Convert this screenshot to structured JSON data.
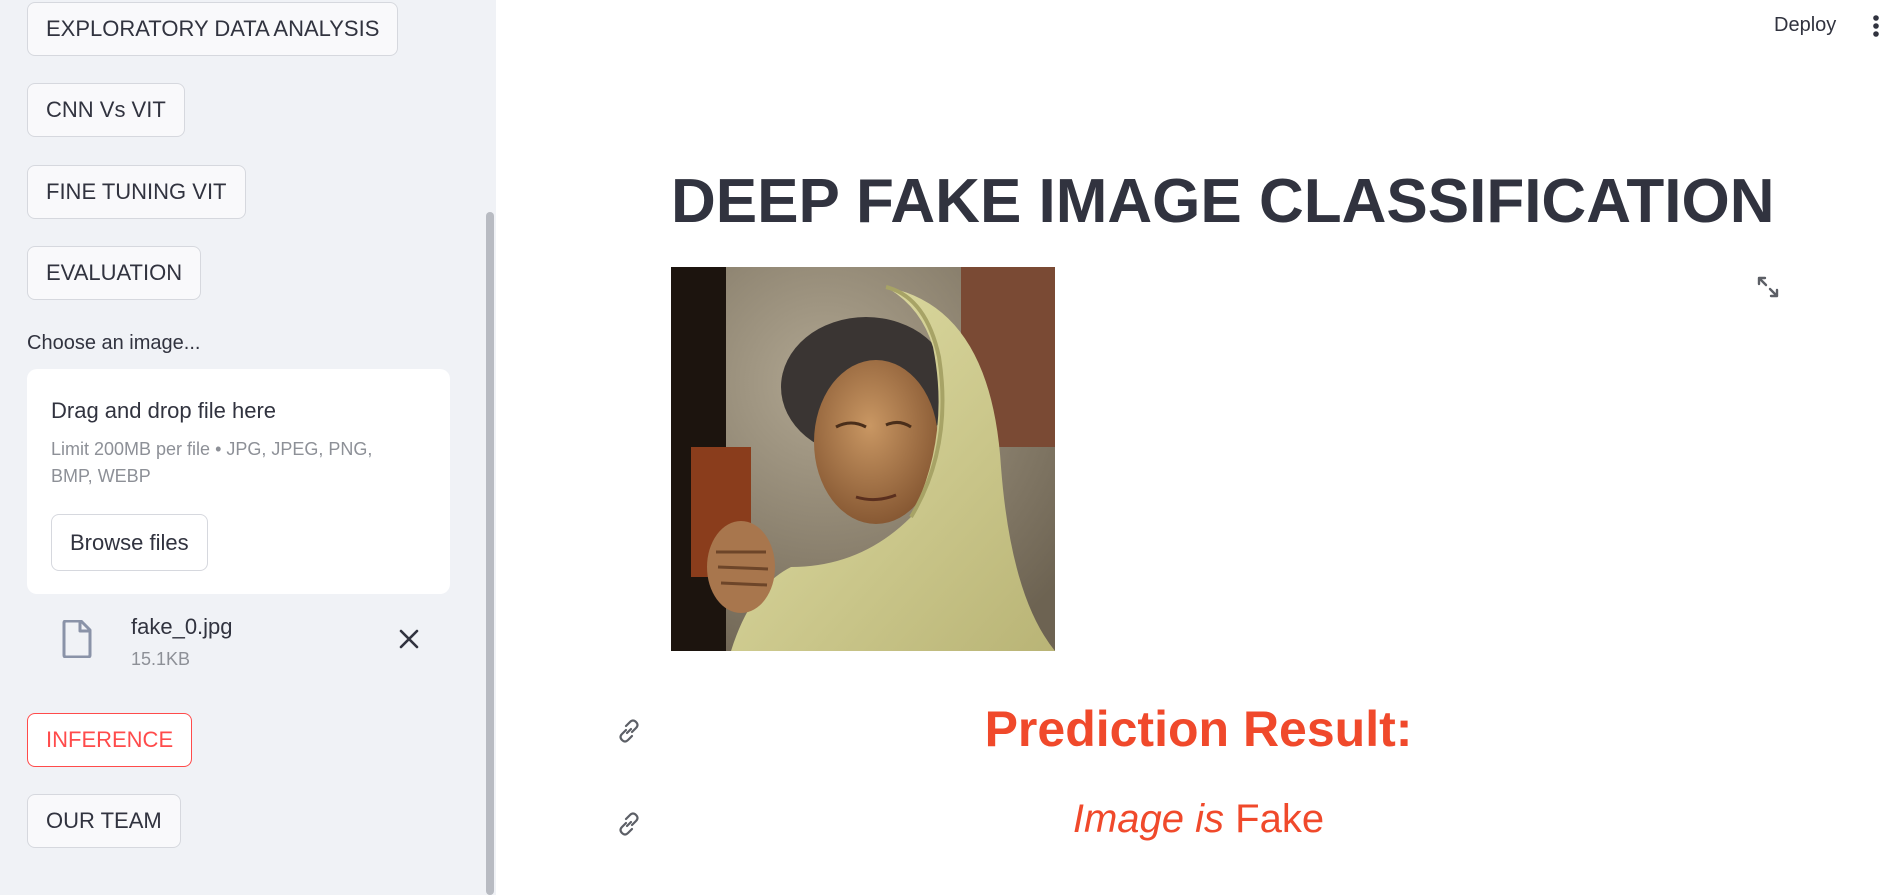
{
  "sidebar": {
    "nav": [
      {
        "label": "EXPLORATORY DATA ANALYSIS"
      },
      {
        "label": "CNN Vs VIT"
      },
      {
        "label": "FINE TUNING VIT"
      },
      {
        "label": "EVALUATION"
      },
      {
        "label": "INFERENCE",
        "active": true
      },
      {
        "label": "OUR TEAM"
      }
    ],
    "uploader": {
      "label": "Choose an image...",
      "drop_title": "Drag and drop file here",
      "limit": "Limit 200MB per file • JPG, JPEG, PNG, BMP, WEBP",
      "browse_label": "Browse files",
      "file": {
        "name": "fake_0.jpg",
        "size": "15.1KB"
      }
    }
  },
  "header": {
    "deploy_label": "Deploy"
  },
  "main": {
    "title": "DEEP FAKE IMAGE CLASSIFICATION",
    "result_heading": "Prediction Result:",
    "result_prefix": "Image is",
    "result_value": "Fake"
  },
  "colors": {
    "accent": "#ff4b4b",
    "result": "#f0492b",
    "sidebar_bg": "#f0f2f6"
  },
  "icons": [
    "file-icon",
    "close-icon",
    "more-vert-icon",
    "expand-icon",
    "link-icon"
  ]
}
